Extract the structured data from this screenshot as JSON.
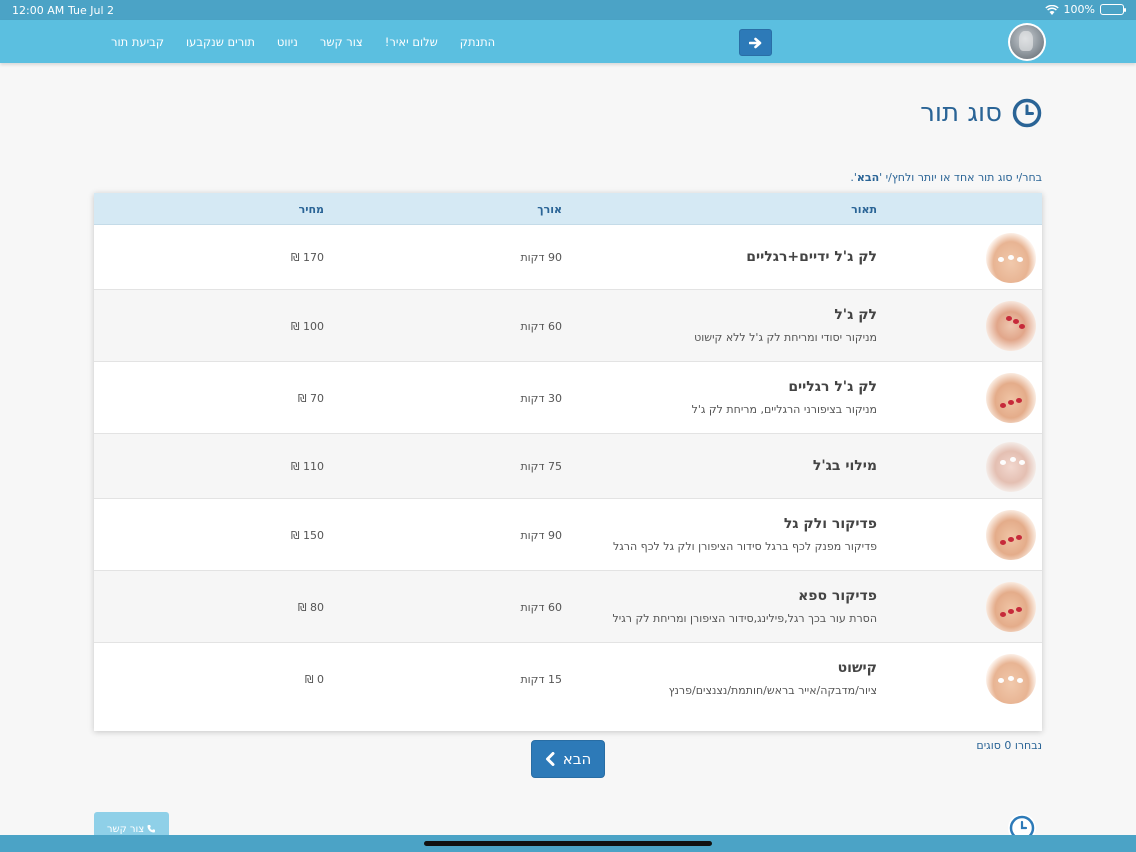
{
  "status_bar": {
    "time": "12:00 AM",
    "date": "Tue Jul 2",
    "battery": "100%"
  },
  "nav": {
    "links": [
      "קביעת תור",
      "תורים שנקבעו",
      "ניווט",
      "צור קשר",
      "שלום יאיר!",
      "התנתק"
    ]
  },
  "page": {
    "title": "סוג תור",
    "instruction_prefix": "בחר/י סוג תור אחד או יותר ולחץ/י '",
    "instruction_strong": "הבא",
    "instruction_suffix": "'."
  },
  "table": {
    "headers": {
      "description": "תאור",
      "duration": "אורך",
      "price": "מחיר"
    },
    "rows": [
      {
        "name": "לק ג'ל ידיים+רגליים",
        "desc": "",
        "duration": "90 דקות",
        "price": "170 ₪"
      },
      {
        "name": "לק ג'ל",
        "desc": "מניקור יסודי ומריחת לק ג'ל ללא קישוט",
        "duration": "60 דקות",
        "price": "100 ₪"
      },
      {
        "name": "לק ג'ל רגליים",
        "desc": "מניקור בציפורני הרגליים, מריחת לק ג'ל",
        "duration": "30 דקות",
        "price": "70 ₪"
      },
      {
        "name": "מילוי בג'ל",
        "desc": "",
        "duration": "75 דקות",
        "price": "110 ₪"
      },
      {
        "name": "פדיקור ולק גל",
        "desc": "פדיקור מפנק לכף ברגל סידור הציפורן ולק גל לכף הרגל",
        "duration": "90 דקות",
        "price": "150 ₪"
      },
      {
        "name": "פדיקור ספא",
        "desc": "הסרת עור בכך רגל,פילינג,סידור הציפורן ומריחת לק רגיל",
        "duration": "60 דקות",
        "price": "80 ₪"
      },
      {
        "name": "קישוט",
        "desc": "ציור/מדבקה/אייר בראש/חותמת/נצנצים/פרנץ",
        "duration": "15 דקות",
        "price": "0 ₪"
      }
    ]
  },
  "selection": {
    "count_text": "נבחרו 0 סוגים"
  },
  "buttons": {
    "next": "הבא",
    "contact": "צור קשר"
  },
  "colors": {
    "nav_bg": "#5bbfe0",
    "primary": "#2d7ab8",
    "header_text": "#2a6496"
  },
  "icons": {
    "nav_button": "arrow-right-icon",
    "title": "clock-icon",
    "next": "chevron-left-icon",
    "contact": "phone-icon",
    "floating": "clock-icon"
  }
}
